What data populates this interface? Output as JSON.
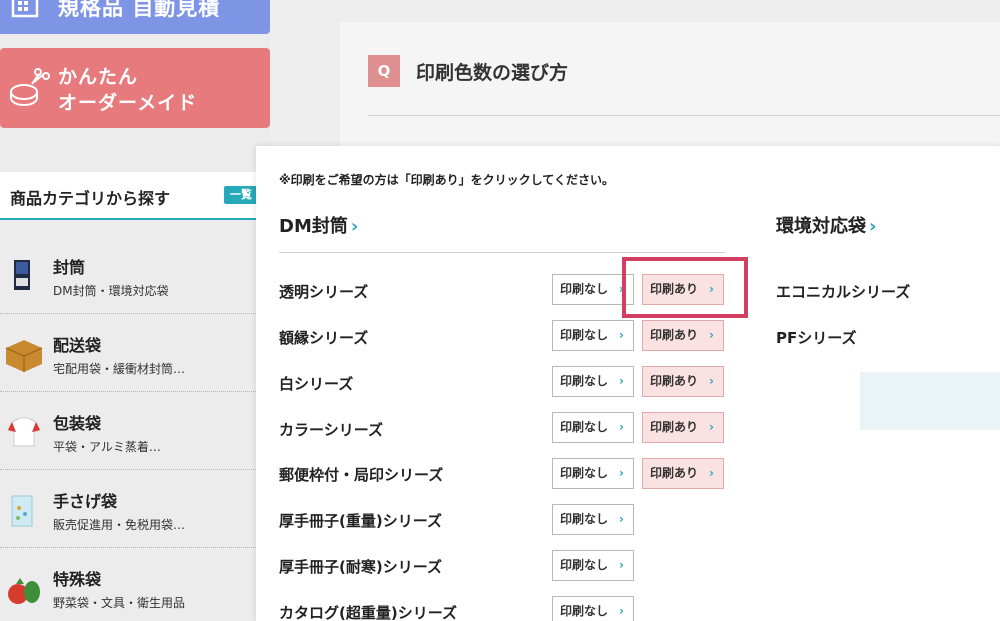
{
  "sidebar": {
    "banner_top": {
      "label": "規格品 自動見積"
    },
    "banner_order": {
      "line1": "かんたん",
      "line2": "オーダーメイド"
    },
    "category": {
      "title": "商品カテゴリから探す",
      "badge": "一覧",
      "items": [
        {
          "name": "封筒",
          "sub": "DM封筒・環境対応袋",
          "icon": "envelope-thumbnail"
        },
        {
          "name": "配送袋",
          "sub": "宅配用袋・緩衝材封筒…",
          "icon": "box-thumbnail"
        },
        {
          "name": "包装袋",
          "sub": "平袋・アルミ蒸着…",
          "icon": "shirt-thumbnail"
        },
        {
          "name": "手さげ袋",
          "sub": "販売促進用・免税用袋…",
          "icon": "bag-thumbnail"
        },
        {
          "name": "特殊袋",
          "sub": "野菜袋・文具・衛生用品",
          "icon": "vegetable-thumbnail"
        }
      ]
    }
  },
  "question": {
    "badge": "Q",
    "title": "印刷色数の選び方"
  },
  "popup": {
    "notice": "※印刷をご希望の方は「印刷あり」をクリックしてください。",
    "left_group": {
      "title": "DM封筒",
      "rows": [
        {
          "label": "透明シリーズ",
          "none": "印刷なし",
          "print": "印刷あり"
        },
        {
          "label": "額縁シリーズ",
          "none": "印刷なし",
          "print": "印刷あり"
        },
        {
          "label": "白シリーズ",
          "none": "印刷なし",
          "print": "印刷あり"
        },
        {
          "label": "カラーシリーズ",
          "none": "印刷なし",
          "print": "印刷あり"
        },
        {
          "label": "郵便枠付・局印シリーズ",
          "none": "印刷なし",
          "print": "印刷あり"
        },
        {
          "label": "厚手冊子(重量)シリーズ",
          "none": "印刷なし"
        },
        {
          "label": "厚手冊子(耐寒)シリーズ",
          "none": "印刷なし"
        },
        {
          "label": "カタログ(超重量)シリーズ",
          "none": "印刷なし"
        }
      ]
    },
    "right_group": {
      "title": "環境対応袋",
      "items": [
        "エコニカルシリーズ",
        "PFシリーズ"
      ]
    }
  },
  "colors": {
    "accent": "#26a9b8",
    "highlight": "#d33f61",
    "print_button_bg": "#fbe2e2",
    "banner_order": "#e67a7d",
    "banner_top": "#7e95e6"
  }
}
